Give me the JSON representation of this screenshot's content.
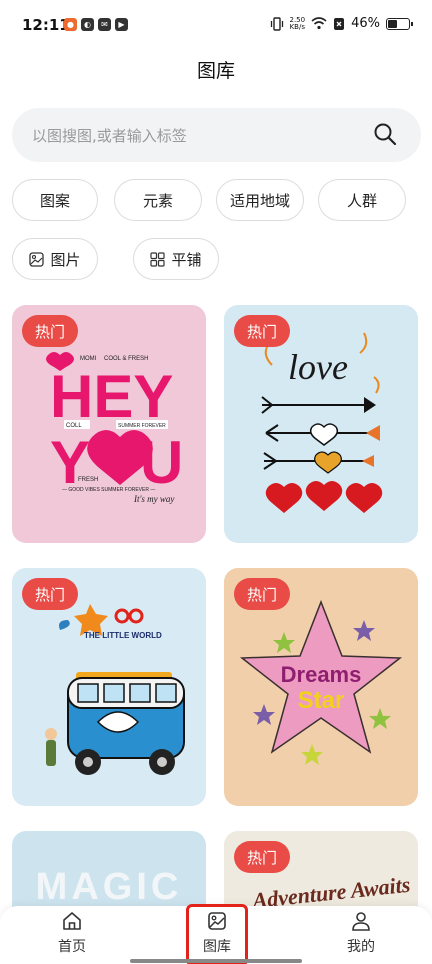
{
  "status_bar": {
    "time": "12:11",
    "net_speed_value": "2.50",
    "net_speed_unit": "KB/s",
    "battery": "46%",
    "battery_level": 0.46
  },
  "header": {
    "title": "图库"
  },
  "search": {
    "placeholder": "以图搜图,或者输入标签"
  },
  "filters": {
    "row1": [
      "图案",
      "元素",
      "适用地域",
      "人群"
    ],
    "image_label": "图片",
    "tile_label": "平铺"
  },
  "cards": [
    {
      "tag": "热门",
      "bg": "#f0c8d7",
      "text_lines": [
        "MOMI",
        "COOL & FRESH",
        "HEY",
        "COLL",
        "SUMMER FOREVER",
        "Y",
        "U",
        "FRESH",
        "— GOOD VIBES SUMMER FOREVER —",
        "It's my way"
      ]
    },
    {
      "tag": "热门",
      "bg": "#d4e9f2",
      "text_lines": [
        "love"
      ]
    },
    {
      "tag": "热门",
      "bg": "#d8eaf4",
      "text_lines": [
        "THE LITTLE WORLD"
      ]
    },
    {
      "tag": "热门",
      "bg": "#f1cfaa",
      "text_lines": [
        "Dreams",
        "Star"
      ]
    },
    {
      "tag": "",
      "bg": "#cde4ef",
      "text_lines": [
        "MAGIC"
      ]
    },
    {
      "tag": "热门",
      "bg": "#eeeadf",
      "text_lines": [
        "Adventure Awaits"
      ]
    }
  ],
  "bottom_nav": {
    "items": [
      {
        "label": "首页",
        "icon": "home-icon"
      },
      {
        "label": "图库",
        "icon": "gallery-icon"
      },
      {
        "label": "我的",
        "icon": "user-icon"
      }
    ],
    "active": "图库"
  },
  "colors": {
    "accent": "#e94b46",
    "highlight": "#e2231a"
  }
}
